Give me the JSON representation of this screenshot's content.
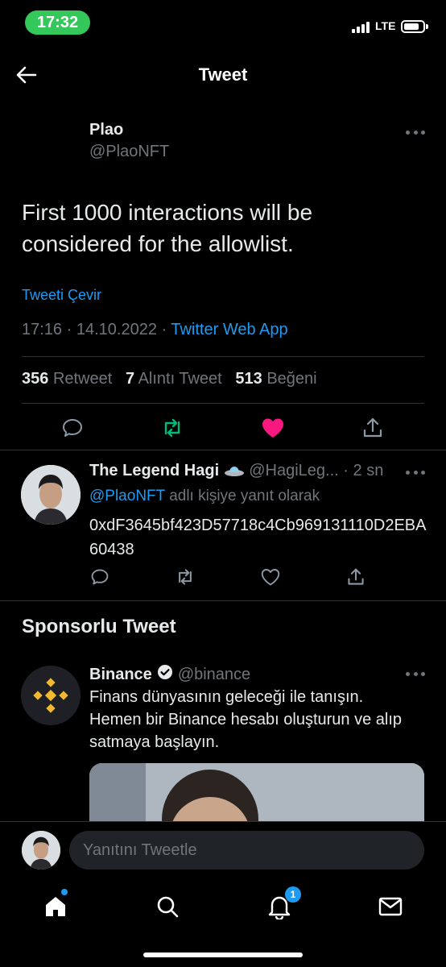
{
  "status_bar": {
    "time": "17:32",
    "network": "LTE"
  },
  "header": {
    "title": "Tweet"
  },
  "tweet": {
    "name": "Plao",
    "handle": "@PlaoNFT",
    "text": "First 1000 interactions will be considered for the allowlist.",
    "translate": "Tweeti Çevir",
    "time": "17:16",
    "date": "14.10.2022",
    "source": "Twitter Web App",
    "retweets": "356",
    "retweets_label": "Retweet",
    "quotes": "7",
    "quotes_label": "Alıntı Tweet",
    "likes": "513",
    "likes_label": "Beğeni",
    "colors": {
      "retweet": "#00ba7c",
      "like": "#f91880"
    }
  },
  "reply": {
    "name": "The Legend Hagi",
    "handle": "@HagiLeg...",
    "age": "2 sn",
    "mention": "@PlaoNFT",
    "replying_suffix": "adlı kişiye yanıt olarak",
    "text": "0xdF3645bf423D57718c4Cb969131110D2EBA60438",
    "emoji_icon": "ufo-icon"
  },
  "sponsored": {
    "title": "Sponsorlu Tweet",
    "name": "Binance",
    "handle": "@binance",
    "text": "Finans dünyasının geleceği ile tanışın. Hemen bir Binance hesabı oluşturun ve alıp satmaya başlayın.",
    "brand_color": "#f3ba2f"
  },
  "compose": {
    "placeholder": "Yanıtını Tweetle"
  },
  "tab_bar": {
    "notifications_badge": "1"
  }
}
